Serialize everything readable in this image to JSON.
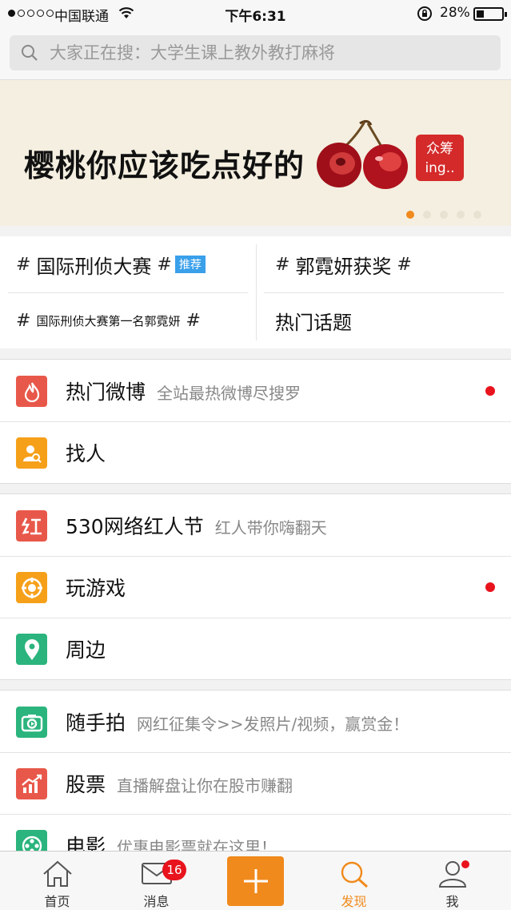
{
  "status": {
    "carrier": "中国联通",
    "time": "下午6:31",
    "battery": "28%",
    "battery_level": 0.28
  },
  "search": {
    "placeholder": "大家正在搜：大学生课上教外教打麻将"
  },
  "banner": {
    "text": "樱桃你应该吃点好的",
    "badge_line1": "众筹",
    "badge_line2": "ing..",
    "page_count": 5,
    "active_page": 1
  },
  "topics": [
    {
      "label": "国际刑侦大赛",
      "badge": "推荐"
    },
    {
      "label": "郭霓妍获奖"
    },
    {
      "label": "国际刑侦大赛第一名郭霓妍"
    },
    {
      "label": "热门话题"
    }
  ],
  "sections": [
    [
      {
        "title": "热门微博",
        "desc": "全站最热微博尽搜罗",
        "icon": "flame-icon",
        "color": "#e8584a",
        "dot": true
      },
      {
        "title": "找人",
        "desc": "",
        "icon": "find-person-icon",
        "color": "#f6a01a",
        "dot": false
      }
    ],
    [
      {
        "title": "530网络红人节",
        "desc": "红人带你嗨翻天",
        "icon": "hong-icon",
        "color": "#e8584a",
        "dot": false
      },
      {
        "title": "玩游戏",
        "desc": "",
        "icon": "gamepad-icon",
        "color": "#f6a01a",
        "dot": true
      },
      {
        "title": "周边",
        "desc": "",
        "icon": "location-pin-icon",
        "color": "#2bb47d",
        "dot": false
      }
    ],
    [
      {
        "title": "随手拍",
        "desc": "网红征集令>>发照片/视频，赢赏金！",
        "icon": "camera-icon",
        "color": "#2bb47d",
        "dot": false
      },
      {
        "title": "股票",
        "desc": "直播解盘让你在股市赚翻",
        "icon": "stock-chart-icon",
        "color": "#e8584a",
        "dot": false
      },
      {
        "title": "电影",
        "desc": "优惠电影票就在这里！",
        "icon": "film-reel-icon",
        "color": "#2bb47d",
        "dot": false
      }
    ]
  ],
  "tabs": {
    "home": "首页",
    "messages": "消息",
    "message_count": "16",
    "discover": "发现",
    "me": "我"
  },
  "colors": {
    "accent": "#f08a1c",
    "alert": "#e8131c",
    "tag_blue": "#3aa0ea"
  }
}
